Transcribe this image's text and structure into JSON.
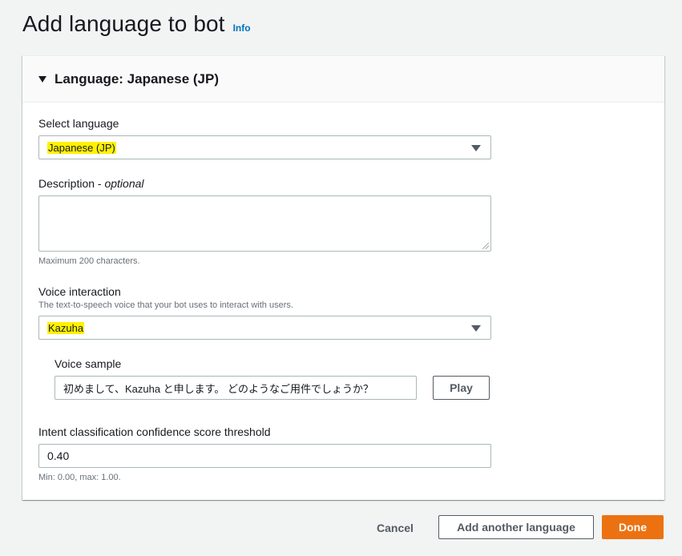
{
  "header": {
    "title": "Add language to bot",
    "info_link": "Info"
  },
  "panel": {
    "title": "Language: Japanese (JP)"
  },
  "select_language": {
    "label": "Select language",
    "value": "Japanese (JP)"
  },
  "description": {
    "label": "Description - ",
    "label_optional": "optional",
    "value": "",
    "hint": "Maximum 200 characters."
  },
  "voice_interaction": {
    "label": "Voice interaction",
    "description": "The text-to-speech voice that your bot uses to interact with users.",
    "value": "Kazuha"
  },
  "voice_sample": {
    "label": "Voice sample",
    "value": "初めまして、Kazuha と申します。 どのようなご用件でしょうか？",
    "play_label": "Play"
  },
  "confidence_threshold": {
    "label": "Intent classification confidence score threshold",
    "value": "0.40",
    "hint": "Min: 0.00, max: 1.00."
  },
  "footer": {
    "cancel_label": "Cancel",
    "add_another_label": "Add another language",
    "done_label": "Done"
  },
  "colors": {
    "primary": "#ec7211",
    "link": "#0073bb",
    "highlight": "#fff200"
  }
}
